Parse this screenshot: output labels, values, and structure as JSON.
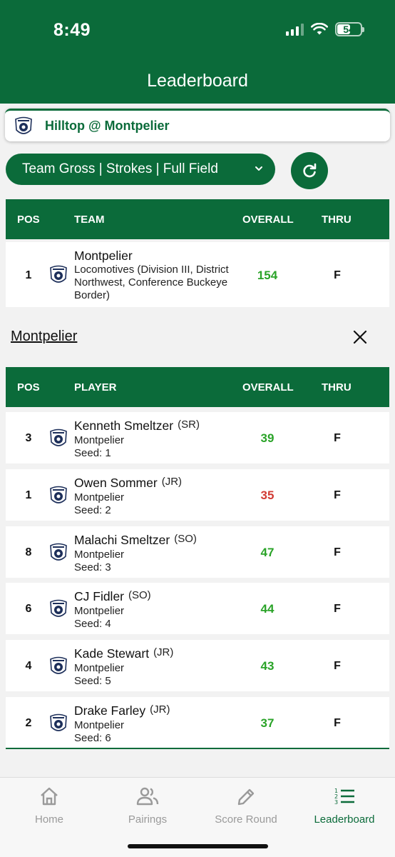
{
  "status_bar": {
    "time": "8:49",
    "battery": "54",
    "battery_level": 0.54
  },
  "header": {
    "title": "Leaderboard"
  },
  "match": {
    "title": "Hilltop @ Montpelier"
  },
  "filter": {
    "selected": "Team Gross | Strokes | Full Field"
  },
  "team_table": {
    "headers": {
      "pos": "POS",
      "team": "TEAM",
      "overall": "OVERALL",
      "thru": "THRU"
    },
    "rows": [
      {
        "pos": "1",
        "name": "Montpelier",
        "detail": "Locomotives (Division III, District Northwest, Conference Buckeye Border)",
        "overall": "154",
        "thru": "F"
      }
    ]
  },
  "team_section": {
    "title": "Montpelier"
  },
  "player_table": {
    "headers": {
      "pos": "POS",
      "player": "PLAYER",
      "overall": "OVERALL",
      "thru": "THRU"
    },
    "rows": [
      {
        "pos": "3",
        "name": "Kenneth Smeltzer",
        "year": "(SR)",
        "team": "Montpelier",
        "seed": "Seed: 1",
        "overall": "39",
        "thru": "F"
      },
      {
        "pos": "1",
        "name": "Owen Sommer",
        "year": "(JR)",
        "team": "Montpelier",
        "seed": "Seed: 2",
        "overall": "35",
        "thru": "F"
      },
      {
        "pos": "8",
        "name": "Malachi Smeltzer",
        "year": "(SO)",
        "team": "Montpelier",
        "seed": "Seed: 3",
        "overall": "47",
        "thru": "F"
      },
      {
        "pos": "6",
        "name": "CJ Fidler",
        "year": "(SO)",
        "team": "Montpelier",
        "seed": "Seed: 4",
        "overall": "44",
        "thru": "F"
      },
      {
        "pos": "4",
        "name": "Kade Stewart",
        "year": "(JR)",
        "team": "Montpelier",
        "seed": "Seed: 5",
        "overall": "43",
        "thru": "F"
      },
      {
        "pos": "2",
        "name": "Drake Farley",
        "year": "(JR)",
        "team": "Montpelier",
        "seed": "Seed: 6",
        "overall": "37",
        "thru": "F"
      }
    ]
  },
  "tabs": [
    {
      "label": "Home",
      "icon": "home-icon"
    },
    {
      "label": "Pairings",
      "icon": "users-icon"
    },
    {
      "label": "Score Round",
      "icon": "pencil-icon"
    },
    {
      "label": "Leaderboard",
      "icon": "leaderboard-icon"
    }
  ],
  "colors": {
    "brand": "#0b6b3a",
    "score_normal": "#2aa328",
    "score_best": "#d23b34"
  }
}
